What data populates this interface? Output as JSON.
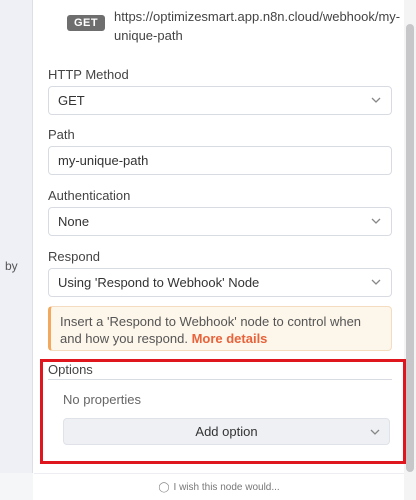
{
  "left_panel": {
    "fragment_text": "by"
  },
  "webhook": {
    "method_badge": "GET",
    "url": "https://optimizesmart.app.n8n.cloud/webhook/my-unique-path"
  },
  "fields": {
    "http_method": {
      "label": "HTTP Method",
      "value": "GET"
    },
    "path": {
      "label": "Path",
      "value": "my-unique-path"
    },
    "authentication": {
      "label": "Authentication",
      "value": "None"
    },
    "respond": {
      "label": "Respond",
      "value": "Using 'Respond to Webhook' Node"
    }
  },
  "notice": {
    "text": "Insert a 'Respond to Webhook' node to control when and how you respond.",
    "link": "More details"
  },
  "options": {
    "title": "Options",
    "empty_text": "No properties",
    "add_button": "Add option"
  },
  "footer": {
    "text": "I wish this node would..."
  },
  "colors": {
    "highlight": "#e0161f",
    "link": "#e8623a",
    "notice_accent": "#f2a85d"
  }
}
